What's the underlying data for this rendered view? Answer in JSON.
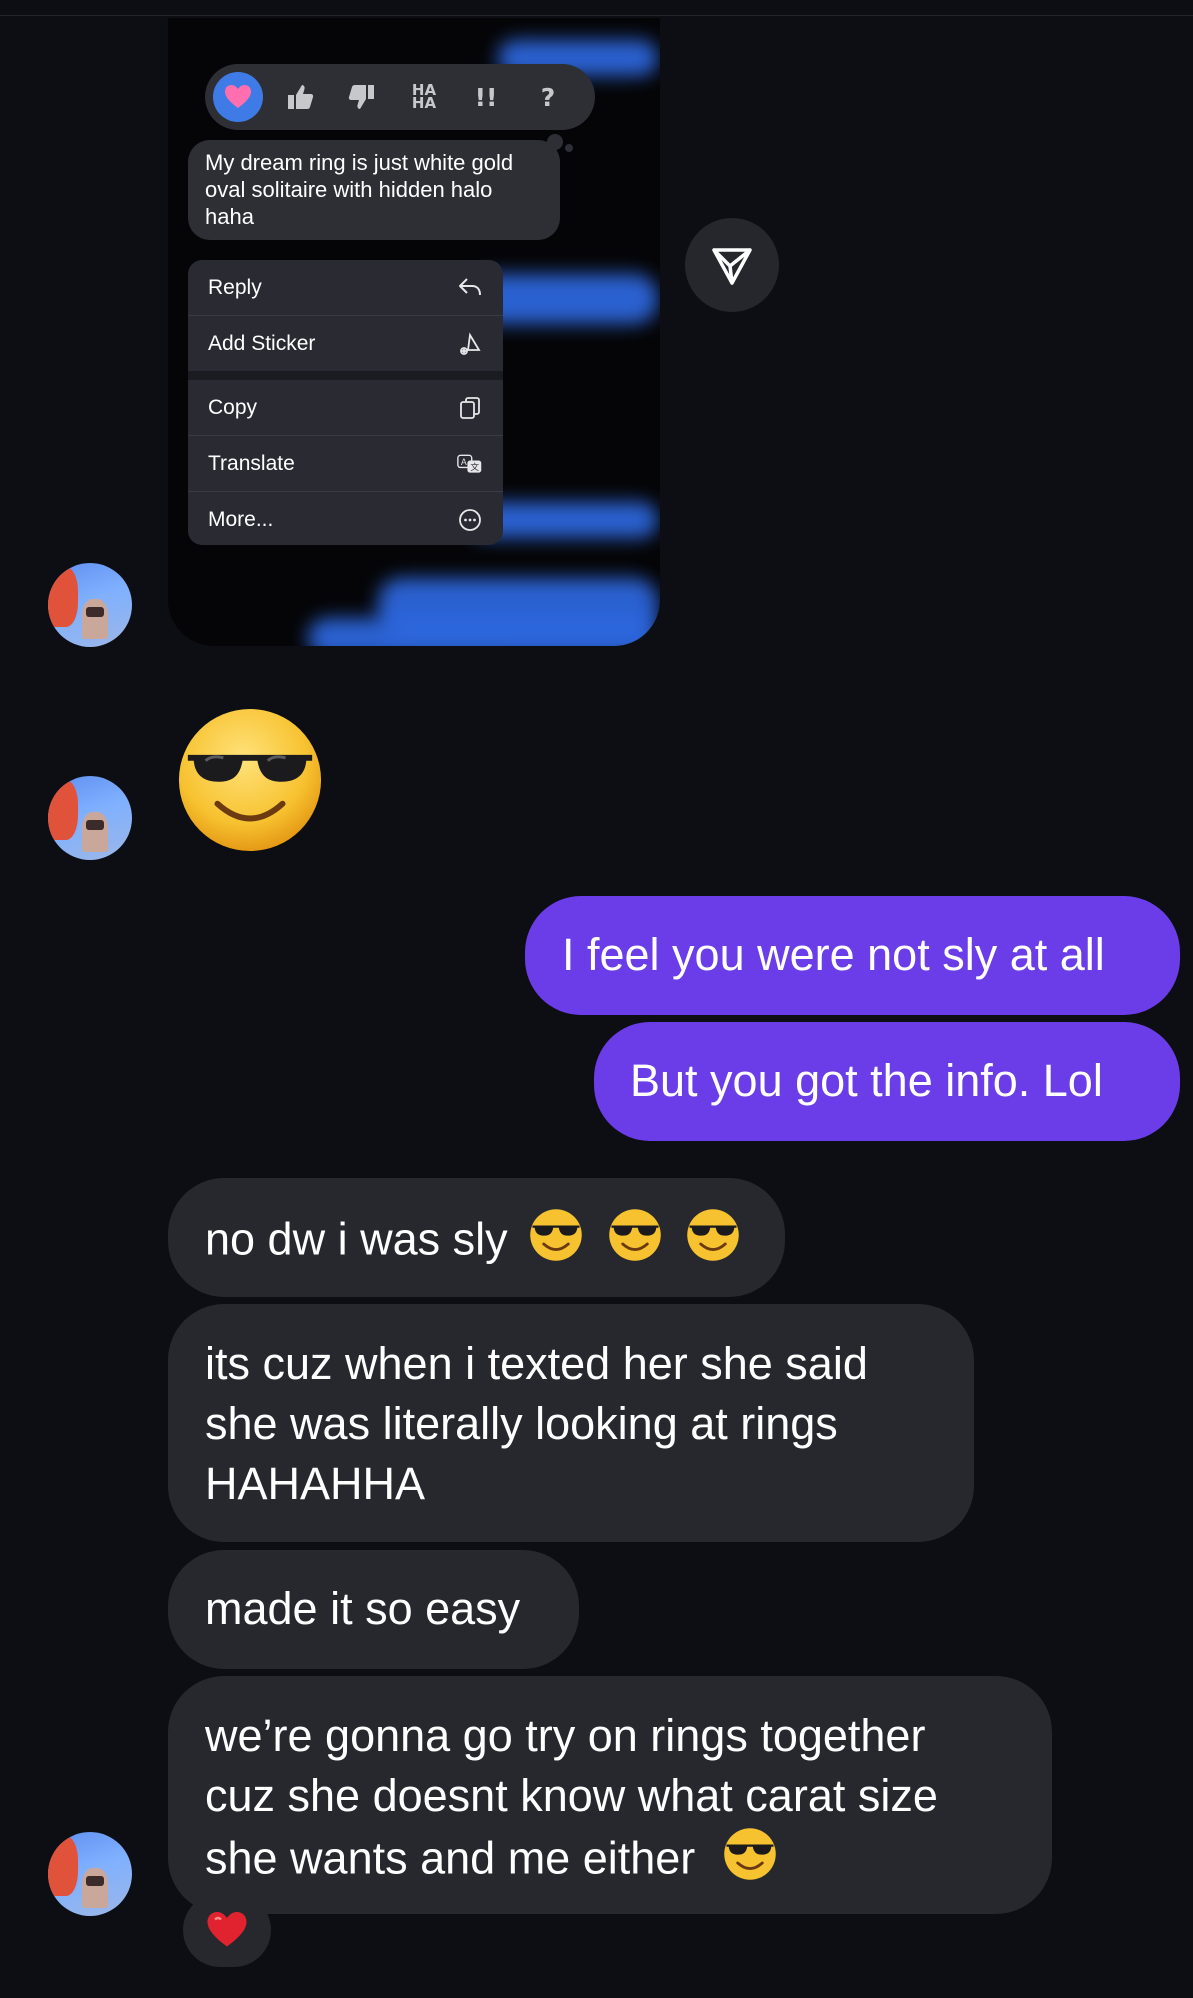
{
  "reaction_bar": {
    "items": [
      {
        "name": "heart",
        "glyph": "♥"
      },
      {
        "name": "thumbs-up",
        "glyph": "👍"
      },
      {
        "name": "thumbs-down",
        "glyph": "👎"
      },
      {
        "name": "haha",
        "glyph": "HA\nHA"
      },
      {
        "name": "exclamation",
        "glyph": "!!"
      },
      {
        "name": "question",
        "glyph": "?"
      }
    ],
    "selected": "heart"
  },
  "preview": {
    "text": "My dream ring is just white gold oval solitaire with hidden halo haha"
  },
  "context_menu": {
    "reply": "Reply",
    "add_sticker": "Add Sticker",
    "copy": "Copy",
    "translate": "Translate",
    "more": "More..."
  },
  "messages": {
    "sent_1": "I feel you were not sly at all",
    "sent_2": "But you got the info. Lol",
    "recv_1": "no dw i was sly",
    "recv_2_line1": "its cuz when i texted her she said",
    "recv_2_line2": "she was literally looking at rings",
    "recv_2_line3": "HAHAHHA",
    "recv_3": "made it so easy",
    "recv_4_line1": "we’re gonna go try on rings together",
    "recv_4_line2": "cuz she doesnt know what carat size",
    "recv_4_line3": "she wants and me either"
  },
  "reactions_on_message": {
    "heart": "❤"
  },
  "colors": {
    "background": "#0d0e13",
    "sent_bubble": "#6a3de8",
    "received_bubble": "#26282e",
    "menu_background": "#2a2b32",
    "reaction_selected": "#3f7be6"
  },
  "icons": {
    "share": "send-icon",
    "emoji": "sunglasses-emoji"
  }
}
